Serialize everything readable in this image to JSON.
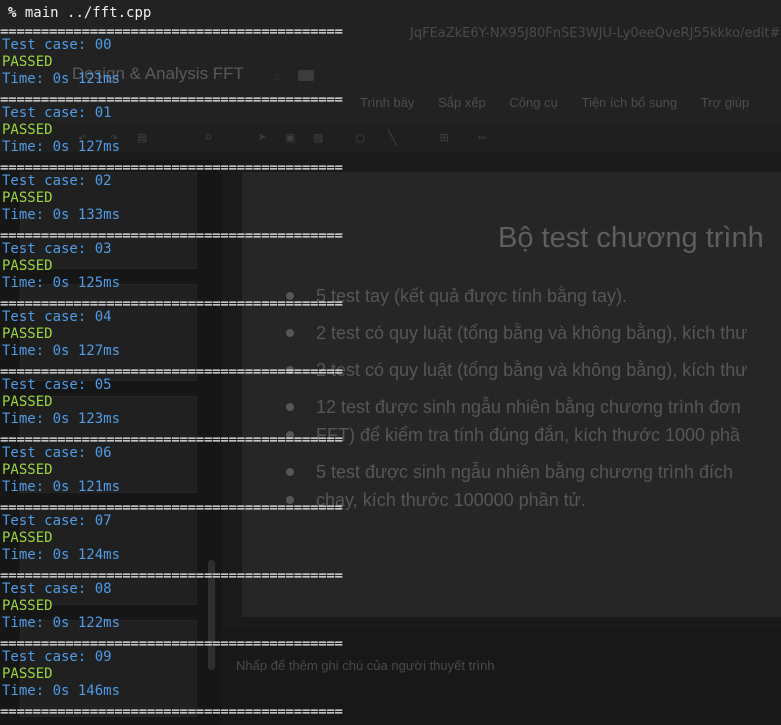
{
  "browser": {
    "url_fragment": "JqFEaZkE6Y-NX95J80FnSE3WJU-Ly0eeQveRJ55kkko/edit#"
  },
  "slides_app": {
    "doc_title": "Design & Analysis FFT",
    "menu": [
      "Trình bày",
      "Sắp xếp",
      "Công cụ",
      "Tiện ích bổ sung",
      "Trợ giúp"
    ],
    "slide_title": "Bộ test chương trình",
    "bullets": [
      "5 test tay (kết quả được tính bằng tay).",
      "2 test có quy luật (tổng bằng và không bằng), kích thư",
      "2 test có quy luật (tổng bằng và không bằng), kích thư",
      "12 test được sinh ngẫu nhiên bằng chương trình đơn",
      "FFT) để kiểm tra tính đúng đắn, kích thước 1000 phầ",
      "5 test được sinh ngẫu nhiên bằng chương trình đích",
      "chạy, kích thước 100000 phần tử."
    ],
    "speaker_notes_placeholder": "Nhấp để thêm ghi chú của người thuyết trình"
  },
  "terminal": {
    "prompt": "%",
    "command": "main ../fft.cpp",
    "separator": "==========================================",
    "results": [
      {
        "label": "Test case: 00",
        "status": "PASSED",
        "time": "Time: 0s 121ms"
      },
      {
        "label": "Test case: 01",
        "status": "PASSED",
        "time": "Time: 0s 127ms"
      },
      {
        "label": "Test case: 02",
        "status": "PASSED",
        "time": "Time: 0s 133ms"
      },
      {
        "label": "Test case: 03",
        "status": "PASSED",
        "time": "Time: 0s 125ms"
      },
      {
        "label": "Test case: 04",
        "status": "PASSED",
        "time": "Time: 0s 127ms"
      },
      {
        "label": "Test case: 05",
        "status": "PASSED",
        "time": "Time: 0s 123ms"
      },
      {
        "label": "Test case: 06",
        "status": "PASSED",
        "time": "Time: 0s 121ms"
      },
      {
        "label": "Test case: 07",
        "status": "PASSED",
        "time": "Time: 0s 124ms"
      },
      {
        "label": "Test case: 08",
        "status": "PASSED",
        "time": "Time: 0s 122ms"
      },
      {
        "label": "Test case: 09",
        "status": "PASSED",
        "time": "Time: 0s 146ms"
      }
    ]
  },
  "colors": {
    "terminal_text": "#f0f0f0",
    "test_case": "#4f9be6",
    "passed": "#9ad63a",
    "background": "#1c1c1c"
  }
}
